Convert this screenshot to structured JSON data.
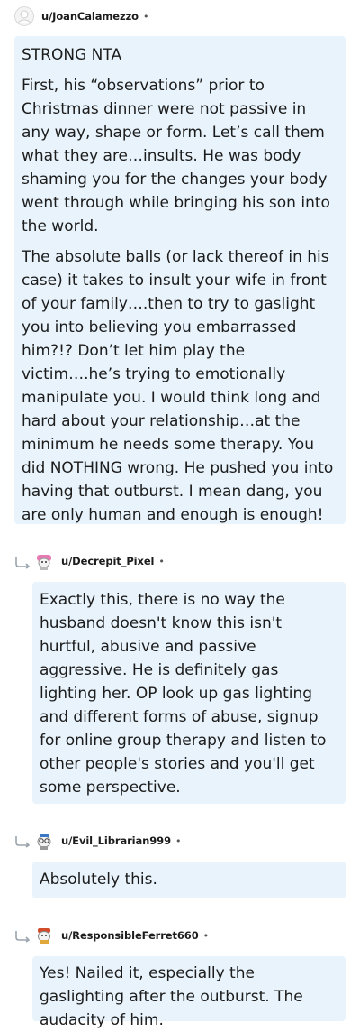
{
  "comments": [
    {
      "username": "u/JoanCalamezzo",
      "separator": "•",
      "paragraphs": [
        "STRONG NTA",
        "First, his “observations” prior to Christmas dinner were not passive in any way, shape or form. Let’s call them what they are…insults. He was body shaming you for the changes your body went through while bringing his son into the world.",
        "The absolute balls (or lack thereof in his case) it takes to insult your wife in front of your family….then to try to gaslight you into believing you embarrassed him?!? Don’t let him play the victim….he’s trying to emotionally manipulate you. I would think long and hard about your relationship…at the minimum he needs some therapy. You did NOTHING wrong. He pushed you into having that outburst. I mean dang, you are only human and enough is enough!"
      ]
    },
    {
      "username": "u/Decrepit_Pixel",
      "separator": "•",
      "paragraphs": [
        "Exactly this, there is no way the husband doesn't know this isn't hurtful, abusive and passive aggressive. He is definitely gas lighting her. OP look up gas lighting and different forms of abuse, signup for online group therapy and listen to other people's stories and you'll get some perspective."
      ]
    },
    {
      "username": "u/Evil_Librarian999",
      "separator": "•",
      "paragraphs": [
        "Absolutely this."
      ]
    },
    {
      "username": "u/ResponsibleFerret660",
      "separator": "•",
      "paragraphs": [
        "Yes! Nailed it, especially the gaslighting after the outburst. The audacity of him."
      ]
    }
  ],
  "colors": {
    "bubble_bg": "#e8f3fb",
    "text": "#1c1c1c",
    "reply_arrow": "#9aa4ad"
  },
  "icons": {
    "reply": "reply-arrow-icon",
    "avatar": "snoo-avatar-icon"
  }
}
